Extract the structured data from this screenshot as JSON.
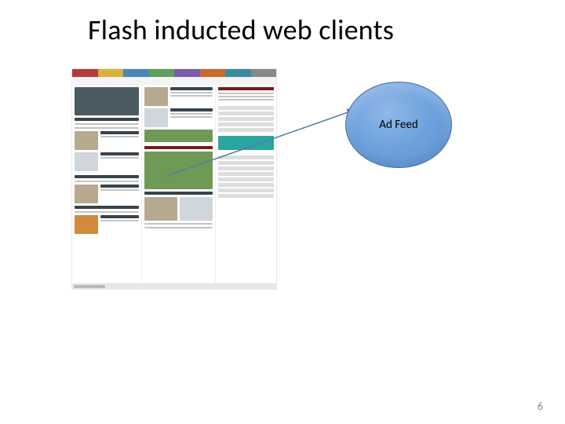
{
  "slide": {
    "title": "Flash inducted web clients",
    "page_number": "6"
  },
  "bubble": {
    "label": "Ad Feed"
  },
  "webshot": {
    "nav_colors": [
      "#b53a3a",
      "#d8b13d",
      "#4a87b5",
      "#5fa05a",
      "#7a5ca8",
      "#c66b2e",
      "#3a8aa0",
      "#888"
    ]
  }
}
